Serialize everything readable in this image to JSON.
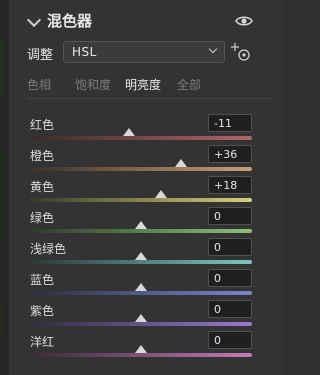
{
  "panel": {
    "title": "混色器",
    "adjust_label": "调整",
    "mode_value": "HSL",
    "tabs": [
      "色相",
      "饱和度",
      "明亮度",
      "全部"
    ],
    "active_tab": 2
  },
  "rows": [
    {
      "label": "红色",
      "value": "-11",
      "level": -11,
      "gradient": [
        "#3a2a2a",
        "#b3646a"
      ]
    },
    {
      "label": "橙色",
      "value": "+36",
      "level": 36,
      "gradient": [
        "#3b302a",
        "#c9a07a"
      ]
    },
    {
      "label": "黄色",
      "value": "+18",
      "level": 18,
      "gradient": [
        "#3a392a",
        "#d6d27a"
      ]
    },
    {
      "label": "绿色",
      "value": "0",
      "level": 0,
      "gradient": [
        "#2c3a2c",
        "#8fc07a"
      ]
    },
    {
      "label": "浅绿色",
      "value": "0",
      "level": 0,
      "gradient": [
        "#2a3938",
        "#7ac7bd"
      ]
    },
    {
      "label": "蓝色",
      "value": "0",
      "level": 0,
      "gradient": [
        "#2a2e3e",
        "#7a86d0"
      ]
    },
    {
      "label": "紫色",
      "value": "0",
      "level": 0,
      "gradient": [
        "#312b3e",
        "#9a7ad2"
      ]
    },
    {
      "label": "洋红",
      "value": "0",
      "level": 0,
      "gradient": [
        "#3a2a38",
        "#c57ab8"
      ]
    }
  ]
}
